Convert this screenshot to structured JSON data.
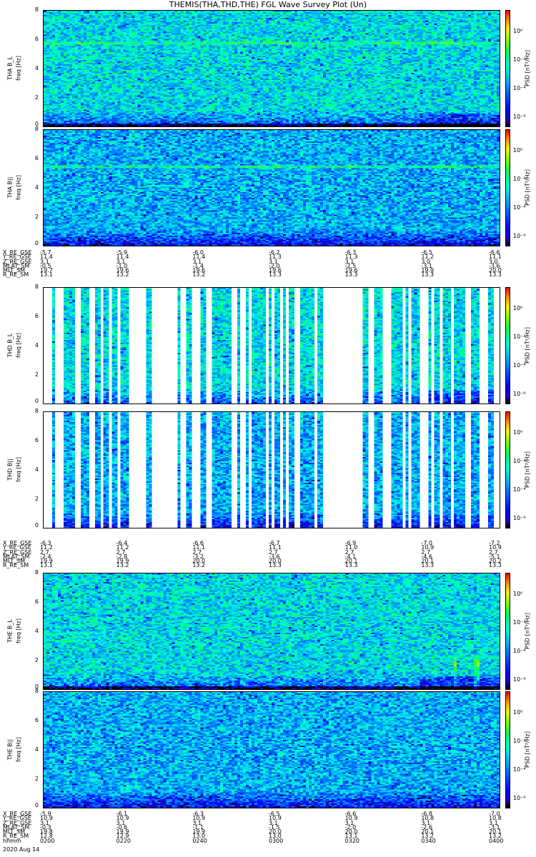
{
  "title": "THEMIS(THA,THD,THE) FGL Wave Survey Plot (Un)",
  "colorbar": {
    "label": "PSD [nT²/Hz]",
    "ticks": [
      "10⁰",
      "10⁻²",
      "10⁻⁴",
      "10⁻⁶"
    ]
  },
  "freq_ticks": [
    "0",
    "2",
    "4",
    "6",
    "8"
  ],
  "panels": [
    {
      "name": "THA B_L",
      "ylabel": "THA B_L",
      "ylabel2": "freq [Hz]"
    },
    {
      "name": "THA B||",
      "ylabel": "THA B||",
      "ylabel2": "freq [Hz]"
    },
    {
      "name": "THD B_L",
      "ylabel": "THD B_L",
      "ylabel2": "freq [Hz]"
    },
    {
      "name": "THD B||",
      "ylabel": "THD B||",
      "ylabel2": "freq [Hz]"
    },
    {
      "name": "THE B_L",
      "ylabel": "THE B_L",
      "ylabel2": "freq [Hz]"
    },
    {
      "name": "THE B||",
      "ylabel": "THE B||",
      "ylabel2": "freq [Hz]"
    }
  ],
  "ephemeris": [
    {
      "probe": "THA",
      "rows": [
        {
          "label": "X_RE_GSE",
          "values": [
            "-5.7",
            "-5.9",
            "-6.0",
            "-6.2",
            "-6.3",
            "-6.5",
            "-6.6"
          ]
        },
        {
          "label": "Y_RE_GSE",
          "values": [
            "11.4",
            "11.4",
            "11.4",
            "11.3",
            "11.3",
            "11.2",
            "11.1"
          ]
        },
        {
          "label": "Z_RE_GSE",
          "values": [
            "3.1",
            "3.1",
            "3.1",
            "3.1",
            "3.1",
            "3.0",
            "3.0"
          ]
        },
        {
          "label": "MLAT_SM",
          "values": [
            "-0.5",
            "-1.0",
            "-1.4",
            "-2.0",
            "-2.5",
            "-3.1",
            "-3.6"
          ]
        },
        {
          "label": "MLT_SM",
          "values": [
            "19.7",
            "19.6",
            "19.6",
            "19.6",
            "19.6",
            "19.9",
            "20.0"
          ]
        },
        {
          "label": "R_RE_SM",
          "values": [
            "13.1",
            "13.2",
            "13.2",
            "13.3",
            "13.3",
            "13.3",
            "13.3"
          ]
        }
      ]
    },
    {
      "probe": "THD",
      "rows": [
        {
          "label": "X_RE_GSE",
          "values": [
            "-6.3",
            "-6.4",
            "-6.6",
            "-6.7",
            "-6.9",
            "-7.0",
            "-7.2"
          ]
        },
        {
          "label": "Y_RE_GSE",
          "values": [
            "11.2",
            "11.2",
            "11.1",
            "11.1",
            "11.0",
            "10.9",
            "10.9"
          ]
        },
        {
          "label": "Z_RE_GSE",
          "values": [
            "2.7",
            "2.7",
            "2.7",
            "2.7",
            "2.7",
            "2.7",
            "2.7"
          ]
        },
        {
          "label": "MLAT_SM",
          "values": [
            "-2.4",
            "-2.8",
            "-3.2",
            "-3.6",
            "-4.1",
            "-4.6",
            "-5.1"
          ]
        },
        {
          "label": "MLT_SM",
          "values": [
            "19.9",
            "19.9",
            "20.0",
            "20.0",
            "20.1",
            "20.1",
            "20.2"
          ]
        },
        {
          "label": "R_RE_SM",
          "values": [
            "13.1",
            "13.2",
            "13.2",
            "13.3",
            "13.3",
            "13.3",
            "13.3"
          ]
        }
      ]
    },
    {
      "probe": "THE",
      "rows": [
        {
          "label": "X_RE_GSE",
          "values": [
            "-5.9",
            "-6.1",
            "-6.3",
            "-6.5",
            "-6.6",
            "-6.8",
            "-7.0"
          ]
        },
        {
          "label": "Y_RE_GSE",
          "values": [
            "10.9",
            "10.9",
            "10.9",
            "10.9",
            "10.9",
            "10.8",
            "10.8"
          ]
        },
        {
          "label": "Z_RE_GSE",
          "values": [
            "3.1",
            "3.1",
            "3.1",
            "3.1",
            "3.1",
            "3.1",
            "3.1"
          ]
        },
        {
          "label": "MLAT_SM",
          "values": [
            "-0.3",
            "-0.6",
            "-1.1",
            "-1.5",
            "-2.0",
            "-2.6",
            "-3.1"
          ]
        },
        {
          "label": "MLT_SM",
          "values": [
            "19.8",
            "19.9",
            "19.9",
            "20.0",
            "20.0",
            "20.1",
            "20.1"
          ]
        },
        {
          "label": "R_RE_SM",
          "values": [
            "12.8",
            "12.9",
            "13.0",
            "13.0",
            "13.1",
            "13.2",
            "13.2"
          ]
        }
      ]
    }
  ],
  "footer": {
    "hhmm_label": "hhmm",
    "times": [
      "0200",
      "0220",
      "0240",
      "0300",
      "0320",
      "0340",
      "0400"
    ],
    "date": "2020 Aug 14"
  },
  "chart_data": [
    {
      "type": "heatmap",
      "title": "THA B_L",
      "ylabel": "freq [Hz]",
      "ylim": [
        0,
        8
      ],
      "x": [
        "0200",
        "0220",
        "0240",
        "0300",
        "0320",
        "0340",
        "0400"
      ],
      "colorscale": "PSD [nT²/Hz]",
      "clim": [
        1e-06,
        10
      ]
    },
    {
      "type": "heatmap",
      "title": "THA B||",
      "ylabel": "freq [Hz]",
      "ylim": [
        0,
        8
      ],
      "x": [
        "0200",
        "0220",
        "0240",
        "0300",
        "0320",
        "0340",
        "0400"
      ]
    },
    {
      "type": "heatmap",
      "title": "THD B_L",
      "ylabel": "freq [Hz]",
      "ylim": [
        0,
        8
      ],
      "x": [
        "0200",
        "0220",
        "0240",
        "0300",
        "0320",
        "0340",
        "0400"
      ]
    },
    {
      "type": "heatmap",
      "title": "THD B||",
      "ylabel": "freq [Hz]",
      "ylim": [
        0,
        8
      ],
      "x": [
        "0200",
        "0220",
        "0240",
        "0300",
        "0320",
        "0340",
        "0400"
      ]
    },
    {
      "type": "heatmap",
      "title": "THE B_L",
      "ylabel": "freq [Hz]",
      "ylim": [
        0,
        8
      ],
      "x": [
        "0200",
        "0220",
        "0240",
        "0300",
        "0320",
        "0340",
        "0400"
      ]
    },
    {
      "type": "heatmap",
      "title": "THE B||",
      "ylabel": "freq [Hz]",
      "ylim": [
        0,
        8
      ],
      "x": [
        "0200",
        "0220",
        "0240",
        "0300",
        "0320",
        "0340",
        "0400"
      ]
    }
  ]
}
